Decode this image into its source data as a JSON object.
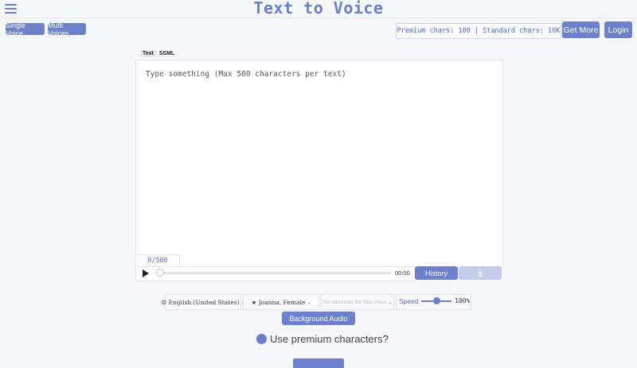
{
  "header": {
    "title": "Text to Voice",
    "menu_icon": "hamburger-icon"
  },
  "modes": {
    "single_label": "Single Voice",
    "multi_label": "Multi Voices"
  },
  "account": {
    "chars_text": "Premium chars: 100 | Standard chars: 10K",
    "get_more_label": "Get More",
    "login_label": "Login"
  },
  "editor": {
    "tabs": [
      {
        "label": "Text",
        "active": true
      },
      {
        "label": "SSML",
        "active": false
      }
    ],
    "placeholder": "Type something (Max 500 characters per text)",
    "value": "",
    "counter": "0/500"
  },
  "player": {
    "time": "00:00",
    "progress": 0,
    "history_label": "History",
    "download_icon": "download-icon"
  },
  "voice_controls": {
    "language": "English (United States)",
    "voice": "Joanna, Female",
    "emotion": "No emotions for this voice",
    "speed_label": "Speed",
    "speed_value": "100%",
    "speed_fraction": 0.5
  },
  "background_audio_label": "Background Audio",
  "premium": {
    "label": "Use premium characters?",
    "checked": true
  },
  "colors": {
    "accent": "#6c80cc",
    "title": "#6a7fc7",
    "background": "#f5f6f9",
    "disabled_button": "#c3cbe8"
  }
}
